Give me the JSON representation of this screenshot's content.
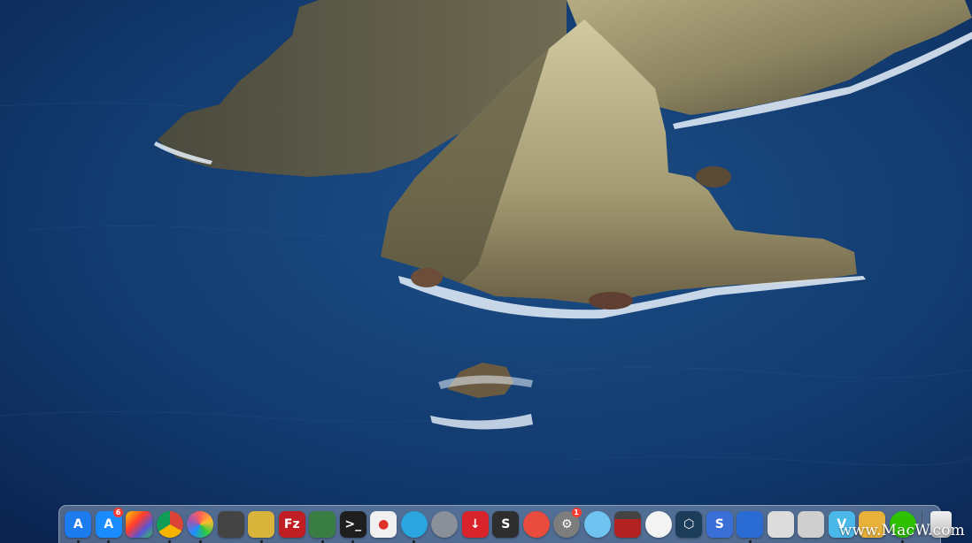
{
  "desktop": {
    "wallpaper": "macOS Catalina island wallpaper",
    "colors": {
      "ocean": "#123a6e",
      "rock": "#8c8460"
    }
  },
  "dock": {
    "items": [
      {
        "name": "Xcode",
        "icon": "xcode-icon",
        "glyph": "A",
        "color": "#1d7bf0",
        "running": true
      },
      {
        "name": "App Store",
        "icon": "app-store-icon",
        "glyph": "A",
        "color": "#1a8cff",
        "badge": "6",
        "running": true
      },
      {
        "name": "Final Cut Pro",
        "icon": "clapper-icon",
        "glyph": "",
        "color": "#2b2b2b",
        "running": false
      },
      {
        "name": "Google Chrome",
        "icon": "chrome-icon",
        "glyph": "",
        "color": "#e0443e",
        "running": true
      },
      {
        "name": "Color Picker",
        "icon": "color-wheel-icon",
        "glyph": "",
        "color": "#9b59b6",
        "running": true
      },
      {
        "name": "Motion",
        "icon": "film-reel-icon",
        "glyph": "",
        "color": "#444444",
        "running": false
      },
      {
        "name": "CleanMyMac",
        "icon": "pineapple-icon",
        "glyph": "",
        "color": "#d9b43a",
        "running": true
      },
      {
        "name": "FileZilla",
        "icon": "filezilla-icon",
        "glyph": "Fz",
        "color": "#bf1e22",
        "running": false
      },
      {
        "name": "Parallels",
        "icon": "display-icon",
        "glyph": "",
        "color": "#3a7d44",
        "running": true
      },
      {
        "name": "Terminal",
        "icon": "terminal-icon",
        "glyph": ">_",
        "color": "#1e1e1e",
        "running": true
      },
      {
        "name": "Screen Recorder",
        "icon": "recorder-icon",
        "glyph": "●",
        "color": "#f0f0f0",
        "running": false
      },
      {
        "name": "QuickLook Search",
        "icon": "search-loop-icon",
        "glyph": "",
        "color": "#2aa5e0",
        "running": true
      },
      {
        "name": "Launchpad",
        "icon": "rocket-icon",
        "glyph": "",
        "color": "#8a8f99",
        "running": false
      },
      {
        "name": "Downie",
        "icon": "download-icon",
        "glyph": "↓",
        "color": "#d8232a",
        "running": false
      },
      {
        "name": "Sublime Text",
        "icon": "sublime-icon",
        "glyph": "S",
        "color": "#2e2e2e",
        "running": false
      },
      {
        "name": "Magnet",
        "icon": "magnet-icon",
        "glyph": "",
        "color": "#e94b3c",
        "running": false
      },
      {
        "name": "System Preferences",
        "icon": "gear-icon",
        "glyph": "⚙",
        "color": "#7d7d7d",
        "badge": "1",
        "running": false
      },
      {
        "name": "Preview",
        "icon": "image-preview-icon",
        "glyph": "",
        "color": "#6fc3f0",
        "running": false
      },
      {
        "name": "Photo Booth",
        "icon": "photo-booth-icon",
        "glyph": "",
        "color": "#b22222",
        "running": false
      },
      {
        "name": "Evernote",
        "icon": "feather-icon",
        "glyph": "",
        "color": "#f4f4f4",
        "running": false
      },
      {
        "name": "Hexagon App",
        "icon": "hexagon-icon",
        "glyph": "⬡",
        "color": "#1c3d5a",
        "running": false
      },
      {
        "name": "Sequel",
        "icon": "s-app-icon",
        "glyph": "S",
        "color": "#3a6fd8",
        "running": false
      },
      {
        "name": "Pencil",
        "icon": "pencil-icon",
        "glyph": "",
        "color": "#2b6cd4",
        "running": true
      },
      {
        "name": "Window Manager",
        "icon": "window-icon",
        "glyph": "",
        "color": "#dcdcdc",
        "running": false
      },
      {
        "name": "Network Utility",
        "icon": "network-icon",
        "glyph": "",
        "color": "#cfcfcf",
        "running": false
      },
      {
        "name": "Vectorize",
        "icon": "v-app-icon",
        "glyph": "V",
        "color": "#4ab8e8",
        "running": false
      },
      {
        "name": "Bundle",
        "icon": "gift-box-icon",
        "glyph": "",
        "color": "#e8b23a",
        "running": false
      },
      {
        "name": "WeChat",
        "icon": "chat-bubble-icon",
        "glyph": "",
        "color": "#2dc100",
        "running": true
      }
    ],
    "trash": {
      "name": "Trash",
      "icon": "trash-icon",
      "color": "#d9d9d9"
    }
  },
  "watermark": {
    "text": "www.MacW.com"
  }
}
